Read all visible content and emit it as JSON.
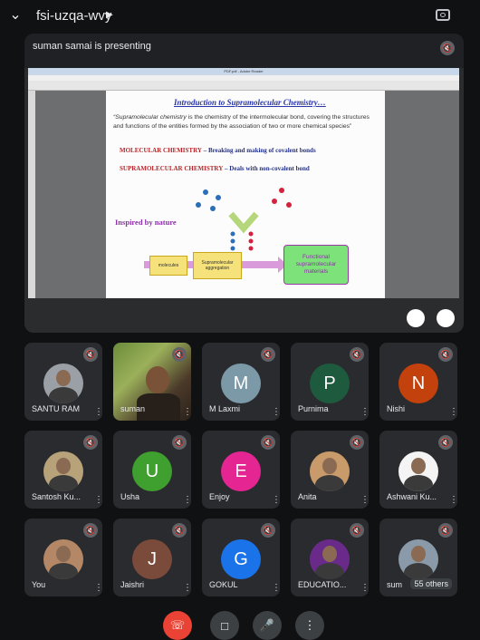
{
  "header": {
    "meeting_code": "fsi-uzqa-wvy"
  },
  "presentation": {
    "label": "suman samai is presenting",
    "window_title": "PDF.pdf - Adobe Reader",
    "slide": {
      "title": "Introduction to Supramolecular Chemistry…",
      "definition_prefix": "“Supramolecular chemistry",
      "definition_rest": " is the chemistry of the intermolecular bond, covering the structures and functions of the entities formed by the association of two or more chemical species”",
      "molecular_label": "MOLECULAR CHEMISTRY",
      "molecular_desc": " – Breaking and making of covalent bonds",
      "supra_label": "SUPRAMOLECULAR CHEMISTRY",
      "supra_desc": " – Deals with non-covalent bond",
      "inspired": "Inspired by nature",
      "box1": "molecules",
      "box2": "Supramolecular aggregation",
      "box3": "Functional supramolecular materials"
    }
  },
  "participants": [
    {
      "name": "SANTU RAM",
      "avatar": "photo",
      "letter": "",
      "color": "#9aa0a6"
    },
    {
      "name": "suman",
      "avatar": "video",
      "letter": "",
      "color": "#6b8c3a"
    },
    {
      "name": "M Laxmi",
      "avatar": "letter",
      "letter": "M",
      "color": "#7b99a6"
    },
    {
      "name": "Purnima",
      "avatar": "letter",
      "letter": "P",
      "color": "#1e5b3e"
    },
    {
      "name": "Nishi",
      "avatar": "letter",
      "letter": "N",
      "color": "#c2410c"
    },
    {
      "name": "Santosh Ku...",
      "avatar": "photo",
      "letter": "",
      "color": "#b7a27a"
    },
    {
      "name": "Usha",
      "avatar": "letter",
      "letter": "U",
      "color": "#3f9f2f"
    },
    {
      "name": "Enjoy",
      "avatar": "letter",
      "letter": "E",
      "color": "#e52592"
    },
    {
      "name": "Anita",
      "avatar": "photo",
      "letter": "",
      "color": "#c99a6a"
    },
    {
      "name": "Ashwani Ku...",
      "avatar": "photo",
      "letter": "",
      "color": "#f4f4f4"
    },
    {
      "name": "You",
      "avatar": "photo",
      "letter": "",
      "color": "#b48866"
    },
    {
      "name": "Jaishri",
      "avatar": "letter",
      "letter": "J",
      "color": "#7a4a3a"
    },
    {
      "name": "GOKUL",
      "avatar": "letter",
      "letter": "G",
      "color": "#1a73e8"
    },
    {
      "name": "EDUCATIO...",
      "avatar": "photo",
      "letter": "",
      "color": "#6a2a8a"
    },
    {
      "name": "sum",
      "avatar": "photo",
      "letter": "",
      "color": "#8a9aa8"
    }
  ],
  "others_count": "55 others",
  "controls": {
    "end_call_icon": "phone-hangup-icon",
    "camera_icon": "camera-off-icon",
    "mic_icon": "mic-off-icon",
    "more_icon": "more-vert-icon"
  },
  "colors": {
    "end_call": "#ea4335",
    "tile_bg": "#2a2b2e",
    "background": "#101113"
  }
}
